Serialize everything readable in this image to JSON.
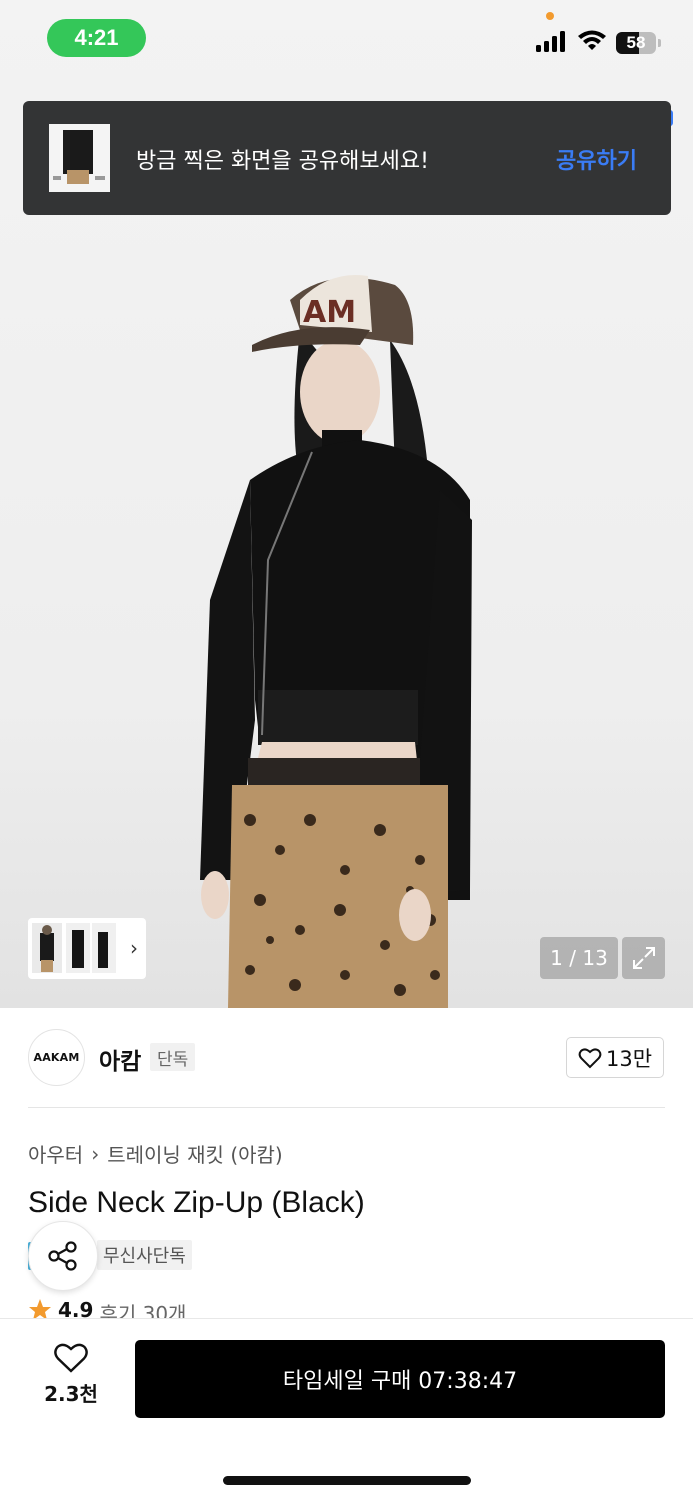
{
  "status_bar": {
    "time": "4:21",
    "battery": "58"
  },
  "toast": {
    "message": "방금 찍은 화면을 공유해보세요!",
    "action": "공유하기"
  },
  "gallery": {
    "counter": "1 / 13"
  },
  "brand": {
    "logo_text": "AAKAM",
    "name": "아캄",
    "badge": "단독",
    "likes": "13만"
  },
  "breadcrumb": {
    "category": "아우터",
    "subcategory": "트레이닝 재킷 (아캄)"
  },
  "product": {
    "title": "Side Neck Zip-Up (Black)",
    "tag": "무신사단독",
    "rating": "4.9",
    "reviews": "후기 30개"
  },
  "bottom": {
    "wish_count": "2.3천",
    "buy_label": "타임세일 구매 07:38:47"
  },
  "colors": {
    "toast_bg": "#333435",
    "toast_action": "#3a7cf5",
    "status_time_bg": "#34c759",
    "buy_bg": "#000000",
    "star": "#f29a2e"
  }
}
